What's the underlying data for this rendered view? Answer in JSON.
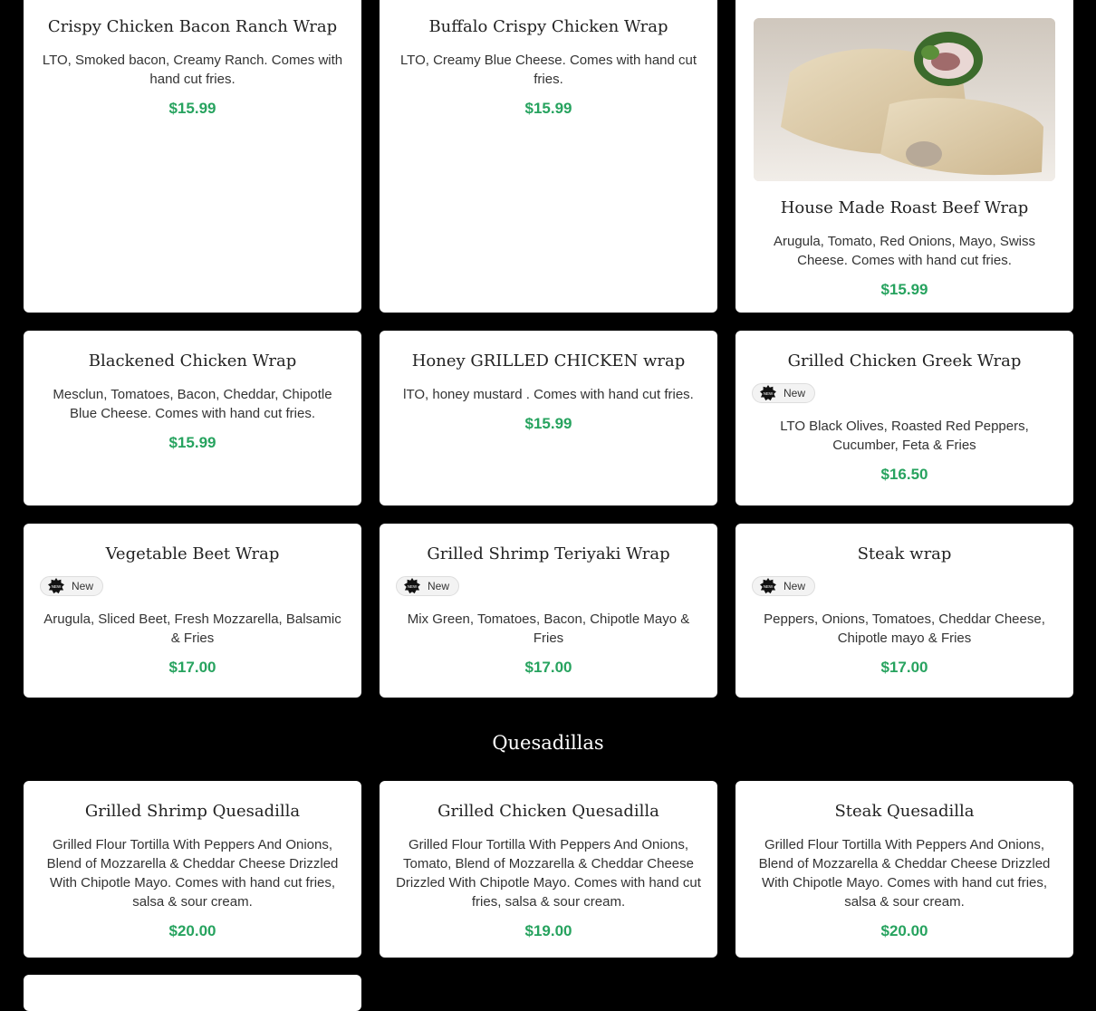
{
  "wraps_row1": [
    {
      "title": "Crispy Chicken Bacon Ranch Wrap",
      "desc": "LTO, Smoked bacon, Creamy Ranch. Comes with hand cut fries.",
      "price": "$15.99"
    },
    {
      "title": "Buffalo Crispy Chicken Wrap",
      "desc": "LTO, Creamy Blue Cheese. Comes with hand cut fries.",
      "price": "$15.99"
    },
    {
      "title": "House Made Roast Beef Wrap",
      "desc": "Arugula, Tomato, Red Onions, Mayo, Swiss Cheese. Comes with hand cut fries.",
      "price": "$15.99"
    }
  ],
  "wraps_row2": [
    {
      "title": "Blackened Chicken Wrap",
      "desc": "Mesclun, Tomatoes, Bacon, Cheddar, Chipotle Blue Cheese. Comes with hand cut fries.",
      "price": "$15.99"
    },
    {
      "title": "Honey GRILLED CHICKEN wrap",
      "desc": "lTO, honey mustard . Comes with hand cut fries.",
      "price": "$15.99"
    },
    {
      "title": "Grilled Chicken Greek Wrap",
      "badge": "New",
      "desc": "LTO Black Olives, Roasted Red Peppers, Cucumber, Feta & Fries",
      "price": "$16.50"
    }
  ],
  "wraps_row3": [
    {
      "title": "Vegetable Beet Wrap",
      "badge": "New",
      "desc": "Arugula, Sliced Beet, Fresh Mozzarella, Balsamic & Fries",
      "price": "$17.00"
    },
    {
      "title": "Grilled Shrimp Teriyaki Wrap",
      "badge": "New",
      "desc": "Mix Green, Tomatoes, Bacon, Chipotle Mayo & Fries",
      "price": "$17.00"
    },
    {
      "title": "Steak wrap",
      "badge": "New",
      "desc": "Peppers, Onions, Tomatoes, Cheddar Cheese, Chipotle mayo & Fries",
      "price": "$17.00"
    }
  ],
  "section_title": "Quesadillas",
  "quesadillas": [
    {
      "title": "Grilled Shrimp Quesadilla",
      "desc": "Grilled Flour Tortilla With Peppers And Onions, Blend of Mozzarella & Cheddar Cheese Drizzled With Chipotle Mayo. Comes with hand cut fries, salsa & sour cream.",
      "price": "$20.00"
    },
    {
      "title": "Grilled Chicken Quesadilla",
      "desc": "Grilled Flour Tortilla With Peppers And Onions, Tomato, Blend of Mozzarella & Cheddar Cheese Drizzled With Chipotle Mayo. Comes with hand cut fries, salsa & sour cream.",
      "price": "$19.00"
    },
    {
      "title": "Steak Quesadilla",
      "desc": "Grilled Flour Tortilla With Peppers And Onions, Blend of Mozzarella & Cheddar Cheese Drizzled With Chipotle Mayo. Comes with hand cut fries, salsa & sour cream.",
      "price": "$20.00"
    }
  ],
  "colors": {
    "background": "#000000",
    "card": "#ffffff",
    "price": "#27a35f"
  },
  "icons": {
    "new_badge": "new-starburst-icon",
    "photo": "roast-beef-wrap-photo"
  }
}
